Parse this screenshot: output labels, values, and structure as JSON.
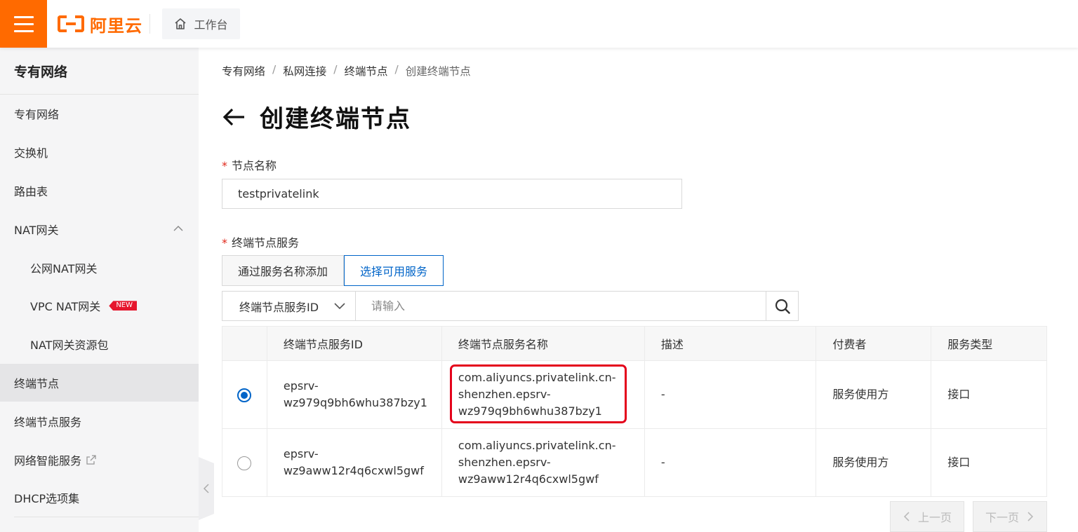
{
  "topbar": {
    "logo_text": "阿里云",
    "workbench_label": "工作台",
    "brand_color": "#ff6a00"
  },
  "sidebar": {
    "title": "专有网络",
    "items": [
      {
        "label": "专有网络"
      },
      {
        "label": "交换机"
      },
      {
        "label": "路由表"
      },
      {
        "label": "NAT网关",
        "expanded": true
      },
      {
        "label": "公网NAT网关",
        "sub": true
      },
      {
        "label": "VPC NAT网关",
        "sub": true,
        "badge": "NEW"
      },
      {
        "label": "NAT网关资源包",
        "sub": true
      },
      {
        "label": "终端节点",
        "active": true
      },
      {
        "label": "终端节点服务"
      },
      {
        "label": "网络智能服务",
        "external": true
      },
      {
        "label": "DHCP选项集"
      }
    ]
  },
  "breadcrumb": [
    "专有网络",
    "私网连接",
    "终端节点",
    "创建终端节点"
  ],
  "breadcrumb_sep": "/",
  "page_title": "创建终端节点",
  "form": {
    "required_mark": "*",
    "name_label": "节点名称",
    "name_value": "testprivatelink",
    "service_label": "终端节点服务",
    "tabs": [
      {
        "label": "通过服务名称添加",
        "active": false
      },
      {
        "label": "选择可用服务",
        "active": true
      }
    ],
    "search": {
      "field": "终端节点服务ID",
      "placeholder": "请输入"
    }
  },
  "table": {
    "headers": [
      "终端节点服务ID",
      "终端节点服务名称",
      "描述",
      "付费者",
      "服务类型"
    ],
    "rows": [
      {
        "selected": true,
        "id": "epsrv-wz979q9bh6whu387bzy1",
        "name": "com.aliyuncs.privatelink.cn-shenzhen.epsrv-wz979q9bh6whu387bzy1",
        "desc": "-",
        "payer": "服务使用方",
        "type": "接口"
      },
      {
        "selected": false,
        "id": "epsrv-wz9aww12r4q6cxwl5gwf",
        "name": "com.aliyuncs.privatelink.cn-shenzhen.epsrv-wz9aww12r4q6cxwl5gwf",
        "desc": "-",
        "payer": "服务使用方",
        "type": "接口"
      }
    ]
  },
  "pagination": {
    "prev": "上一页",
    "next": "下一页"
  },
  "colors": {
    "primary": "#0064c8",
    "highlight": "#e4001b"
  }
}
